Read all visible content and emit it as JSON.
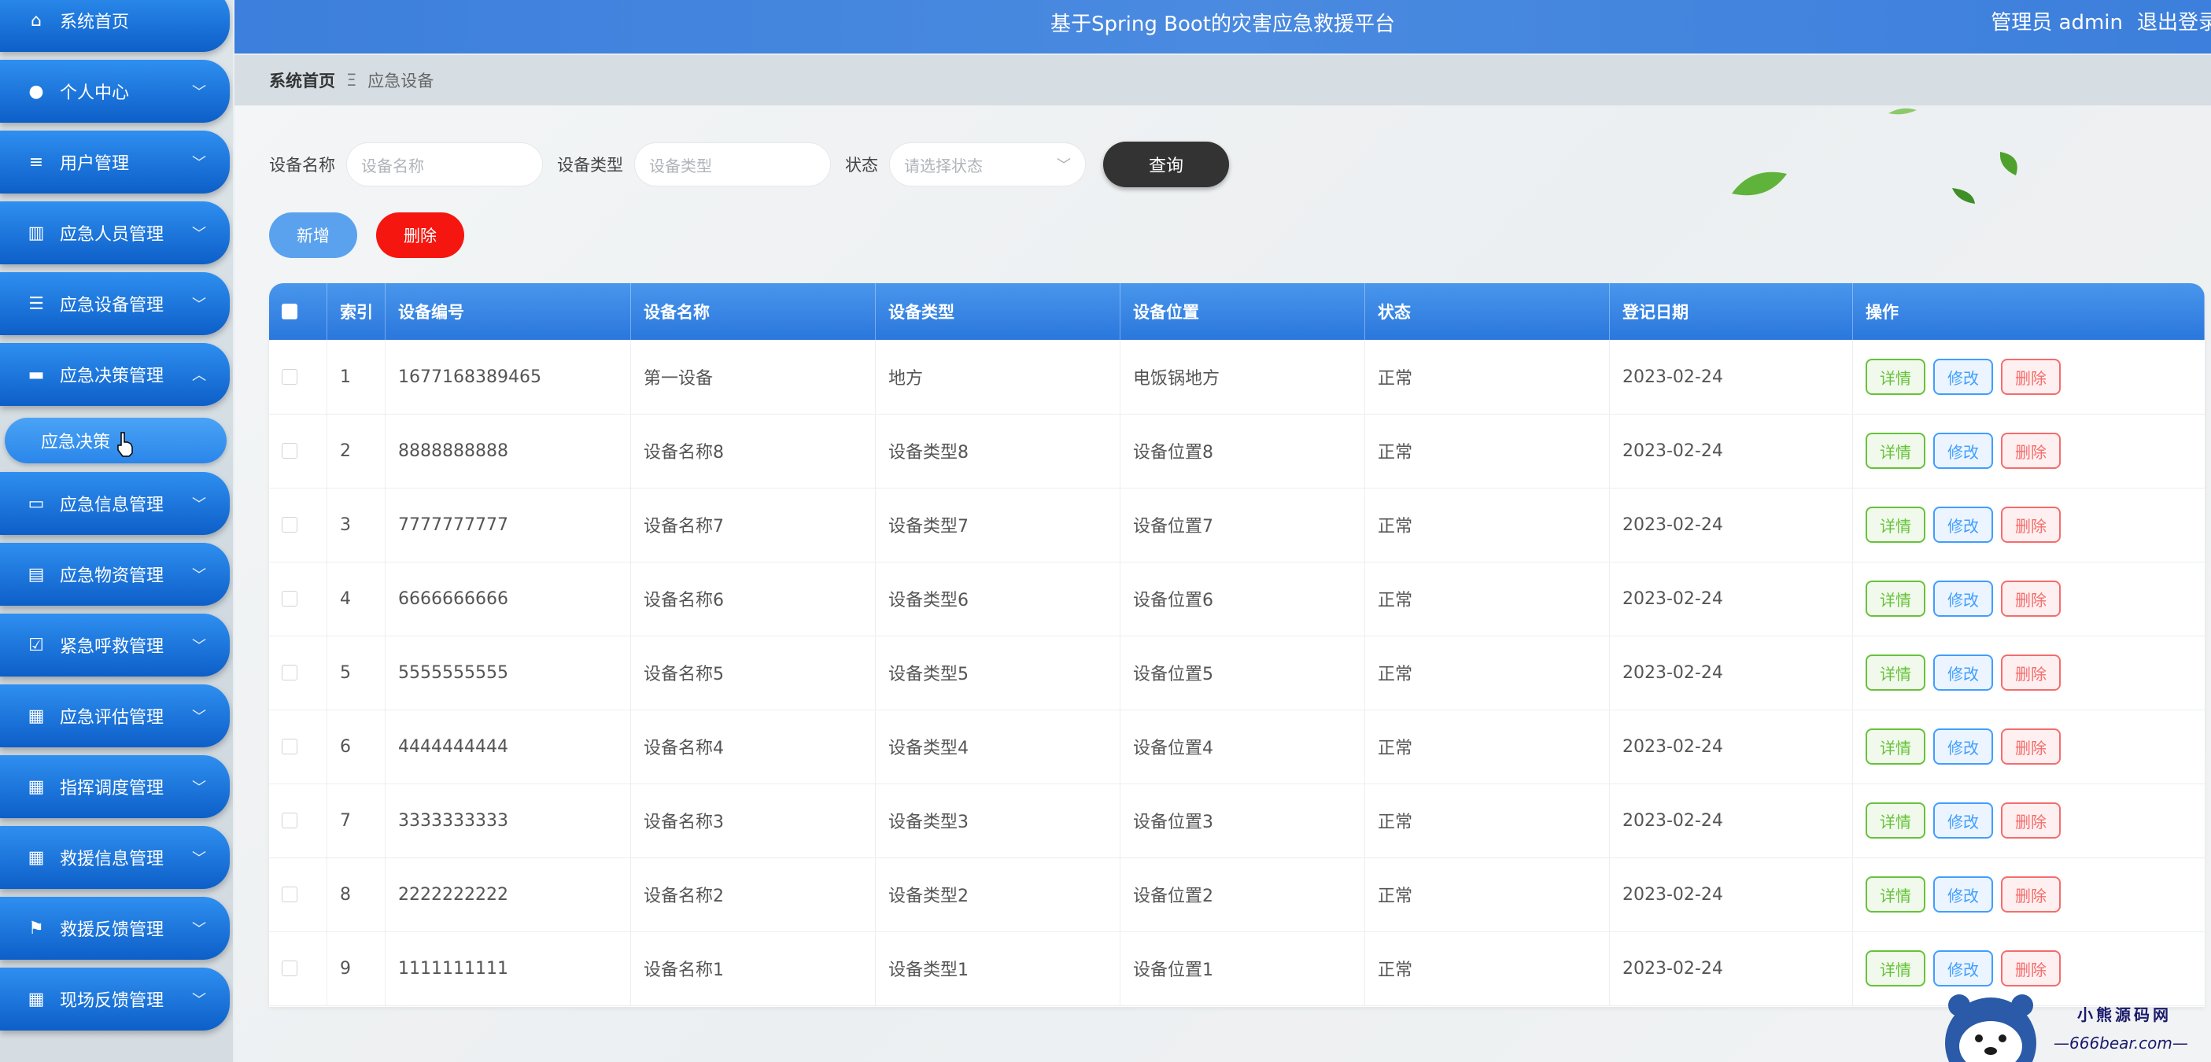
{
  "header": {
    "title": "基于Spring Boot的灾害应急救援平台",
    "user_label": "管理员 admin",
    "logout_label": "退出登录"
  },
  "sidebar": {
    "items": [
      {
        "label": "系统首页",
        "icon": "home-icon",
        "chevron": ""
      },
      {
        "label": "个人中心",
        "icon": "user-icon",
        "chevron": "﹀"
      },
      {
        "label": "用户管理",
        "icon": "list-icon",
        "chevron": "﹀"
      },
      {
        "label": "应急人员管理",
        "icon": "book-icon",
        "chevron": "﹀"
      },
      {
        "label": "应急设备管理",
        "icon": "menu-icon",
        "chevron": "﹀"
      },
      {
        "label": "应急决策管理",
        "icon": "folder-icon",
        "chevron": "︿"
      },
      {
        "label": "应急信息管理",
        "icon": "monitor-icon",
        "chevron": "﹀"
      },
      {
        "label": "应急物资管理",
        "icon": "clipboard-icon",
        "chevron": "﹀"
      },
      {
        "label": "紧急呼救管理",
        "icon": "check-clipboard-icon",
        "chevron": "﹀"
      },
      {
        "label": "应急评估管理",
        "icon": "grid-icon",
        "chevron": "﹀"
      },
      {
        "label": "指挥调度管理",
        "icon": "grid-icon",
        "chevron": "﹀"
      },
      {
        "label": "救援信息管理",
        "icon": "grid-icon",
        "chevron": "﹀"
      },
      {
        "label": "救援反馈管理",
        "icon": "flag-icon",
        "chevron": "﹀"
      },
      {
        "label": "现场反馈管理",
        "icon": "grid-icon",
        "chevron": "﹀"
      }
    ],
    "submenu": {
      "label": "应急决策"
    }
  },
  "breadcrumb": {
    "home": "系统首页",
    "separator": "Ξ",
    "current": "应急设备"
  },
  "search": {
    "name_label": "设备名称",
    "name_placeholder": "设备名称",
    "type_label": "设备类型",
    "type_placeholder": "设备类型",
    "status_label": "状态",
    "status_placeholder": "请选择状态",
    "query_button": "查询"
  },
  "actions": {
    "add_button": "新增",
    "delete_button": "删除"
  },
  "table": {
    "columns": [
      "索引",
      "设备编号",
      "设备名称",
      "设备类型",
      "设备位置",
      "状态",
      "登记日期",
      "操作"
    ],
    "op_labels": {
      "detail": "详情",
      "edit": "修改",
      "delete": "删除"
    },
    "rows": [
      {
        "index": "1",
        "code": "1677168389465",
        "name": "第一设备",
        "type": "地方",
        "location": "电饭锅地方",
        "status": "正常",
        "date": "2023-02-24"
      },
      {
        "index": "2",
        "code": "8888888888",
        "name": "设备名称8",
        "type": "设备类型8",
        "location": "设备位置8",
        "status": "正常",
        "date": "2023-02-24"
      },
      {
        "index": "3",
        "code": "7777777777",
        "name": "设备名称7",
        "type": "设备类型7",
        "location": "设备位置7",
        "status": "正常",
        "date": "2023-02-24"
      },
      {
        "index": "4",
        "code": "6666666666",
        "name": "设备名称6",
        "type": "设备类型6",
        "location": "设备位置6",
        "status": "正常",
        "date": "2023-02-24"
      },
      {
        "index": "5",
        "code": "5555555555",
        "name": "设备名称5",
        "type": "设备类型5",
        "location": "设备位置5",
        "status": "正常",
        "date": "2023-02-24"
      },
      {
        "index": "6",
        "code": "4444444444",
        "name": "设备名称4",
        "type": "设备类型4",
        "location": "设备位置4",
        "status": "正常",
        "date": "2023-02-24"
      },
      {
        "index": "7",
        "code": "3333333333",
        "name": "设备名称3",
        "type": "设备类型3",
        "location": "设备位置3",
        "status": "正常",
        "date": "2023-02-24"
      },
      {
        "index": "8",
        "code": "2222222222",
        "name": "设备名称2",
        "type": "设备类型2",
        "location": "设备位置2",
        "status": "正常",
        "date": "2023-02-24"
      },
      {
        "index": "9",
        "code": "1111111111",
        "name": "设备名称1",
        "type": "设备类型1",
        "location": "设备位置1",
        "status": "正常",
        "date": "2023-02-24"
      }
    ]
  },
  "watermark": {
    "text": "小熊源码网",
    "url": "—666bear.com—"
  },
  "colors": {
    "header": "#3c7fdc",
    "sidebar_item": "#1a74dc",
    "table_header": "#3a86e6",
    "query_button": "#333333",
    "add_button": "#5ba2ee",
    "delete_button": "#f5160f",
    "detail": "#67c23a",
    "edit": "#409eff",
    "op_delete": "#f56c6c"
  }
}
